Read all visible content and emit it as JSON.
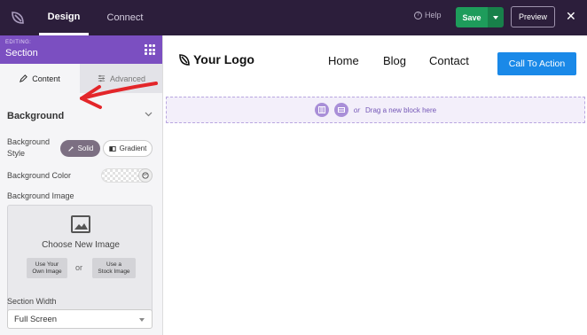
{
  "topbar": {
    "tabs": [
      "Design",
      "Connect"
    ],
    "help_label": "Help",
    "save_label": "Save",
    "preview_label": "Preview",
    "close_symbol": "✕"
  },
  "sidebar": {
    "editing_label": "EDITING:",
    "section_title": "Section",
    "tabs": {
      "content": "Content",
      "advanced": "Advanced"
    },
    "background_heading": "Background",
    "background_style_label_line1": "Background",
    "background_style_label_line2": "Style",
    "style_options": {
      "solid": "Solid",
      "gradient": "Gradient"
    },
    "background_color_label": "Background Color",
    "background_image_label": "Background Image",
    "choose_image_label": "Choose New Image",
    "own_image_line1": "Use Your",
    "own_image_line2": "Own Image",
    "or_label": "or",
    "stock_image_line1": "Use a",
    "stock_image_line2": "Stock Image",
    "section_width_label": "Section Width",
    "section_width_value": "Full Screen"
  },
  "canvas": {
    "logo_text": "Your Logo",
    "nav": [
      "Home",
      "Blog",
      "Contact"
    ],
    "cta_label": "Call To Action",
    "drop_or": "or",
    "drop_text": "Drag a new block here"
  },
  "colors": {
    "topbar_bg": "#2c1e3b",
    "edit_header": "#7b4fc1",
    "save_green": "#1e9c5b",
    "cta_blue": "#1a89e8",
    "annotation_red": "#e3262a"
  }
}
